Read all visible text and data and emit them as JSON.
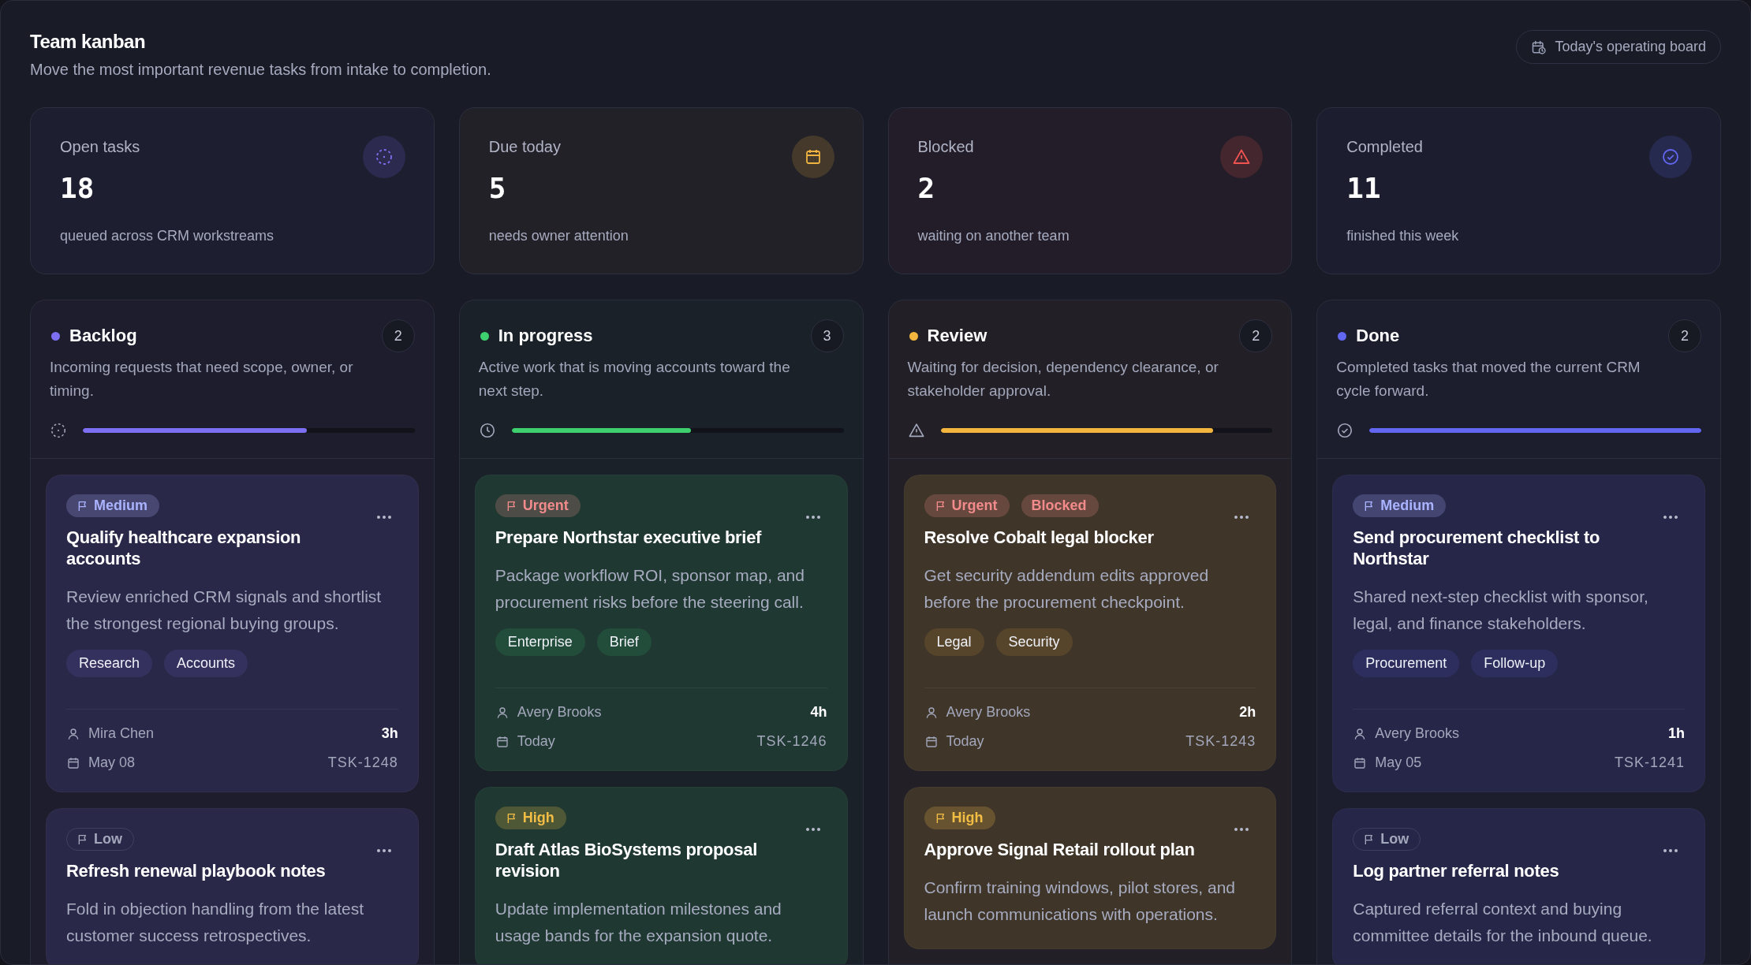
{
  "header": {
    "title": "Team kanban",
    "subtitle": "Move the most important revenue tasks from intake to completion.",
    "board_button": "Today's operating board"
  },
  "stats": [
    {
      "label": "Open tasks",
      "value": "18",
      "caption": "queued across CRM workstreams",
      "color": "#7c6ff2"
    },
    {
      "label": "Due today",
      "value": "5",
      "caption": "needs owner attention",
      "color": "#f0b440"
    },
    {
      "label": "Blocked",
      "value": "2",
      "caption": "waiting on another team",
      "color": "#ef5350"
    },
    {
      "label": "Completed",
      "value": "11",
      "caption": "finished this week",
      "color": "#6366f1"
    }
  ],
  "columns": [
    {
      "title": "Backlog",
      "count": "2",
      "description": "Incoming requests that need scope, owner, or timing.",
      "color": "#7c6ff2",
      "level": 0.675,
      "cards": [
        {
          "badges": [
            {
              "label": "Medium",
              "kind": "flag",
              "color": "#aab3ff"
            }
          ],
          "title": "Qualify healthcare expansion accounts",
          "description": "Review enriched CRM signals and shortlist the strongest regional buying groups.",
          "tags": [
            "Research",
            "Accounts"
          ],
          "assignee": "Mira Chen",
          "estimate": "3h",
          "date": "May 08",
          "id": "TSK-1248"
        },
        {
          "badges": [
            {
              "label": "Low",
              "kind": "outline",
              "color": "#a3a7bb"
            }
          ],
          "title": "Refresh renewal playbook notes",
          "description": "Fold in objection handling from the latest customer success retrospectives."
        }
      ]
    },
    {
      "title": "In progress",
      "count": "3",
      "description": "Active work that is moving accounts toward the next step.",
      "color": "#3ecf6e",
      "level": 0.54,
      "cards": [
        {
          "badges": [
            {
              "label": "Urgent",
              "kind": "flag",
              "color": "#f28b8b"
            }
          ],
          "title": "Prepare Northstar executive brief",
          "description": "Package workflow ROI, sponsor map, and procurement risks before the steering call.",
          "tags": [
            "Enterprise",
            "Brief"
          ],
          "assignee": "Avery Brooks",
          "estimate": "4h",
          "date": "Today",
          "id": "TSK-1246"
        },
        {
          "badges": [
            {
              "label": "High",
              "kind": "flag",
              "color": "#f2bd45"
            }
          ],
          "title": "Draft Atlas BioSystems proposal revision",
          "description": "Update implementation milestones and usage bands for the expansion quote."
        }
      ]
    },
    {
      "title": "Review",
      "count": "2",
      "description": "Waiting for decision, dependency clearance, or stakeholder approval.",
      "color": "#f4b53f",
      "level": 0.82,
      "cards": [
        {
          "badges": [
            {
              "label": "Urgent",
              "kind": "flag",
              "color": "#f28b8b"
            },
            {
              "label": "Blocked",
              "kind": "plain",
              "color": "#f28b8b"
            }
          ],
          "title": "Resolve Cobalt legal blocker",
          "description": "Get security addendum edits approved before the procurement checkpoint.",
          "tags": [
            "Legal",
            "Security"
          ],
          "assignee": "Avery Brooks",
          "estimate": "2h",
          "date": "Today",
          "id": "TSK-1243"
        },
        {
          "badges": [
            {
              "label": "High",
              "kind": "flag",
              "color": "#f2bd45"
            }
          ],
          "title": "Approve Signal Retail rollout plan",
          "description": "Confirm training windows, pilot stores, and launch communications with operations."
        }
      ]
    },
    {
      "title": "Done",
      "count": "2",
      "description": "Completed tasks that moved the current CRM cycle forward.",
      "color": "#6366f1",
      "level": 1.0,
      "cards": [
        {
          "badges": [
            {
              "label": "Medium",
              "kind": "flag",
              "color": "#aab3ff"
            }
          ],
          "title": "Send procurement checklist to Northstar",
          "description": "Shared next-step checklist with sponsor, legal, and finance stakeholders.",
          "tags": [
            "Procurement",
            "Follow-up"
          ],
          "assignee": "Avery Brooks",
          "estimate": "1h",
          "date": "May 05",
          "id": "TSK-1241"
        },
        {
          "badges": [
            {
              "label": "Low",
              "kind": "outline",
              "color": "#a3a7bb"
            }
          ],
          "title": "Log partner referral notes",
          "description": "Captured referral context and buying committee details for the inbound queue."
        }
      ]
    }
  ]
}
